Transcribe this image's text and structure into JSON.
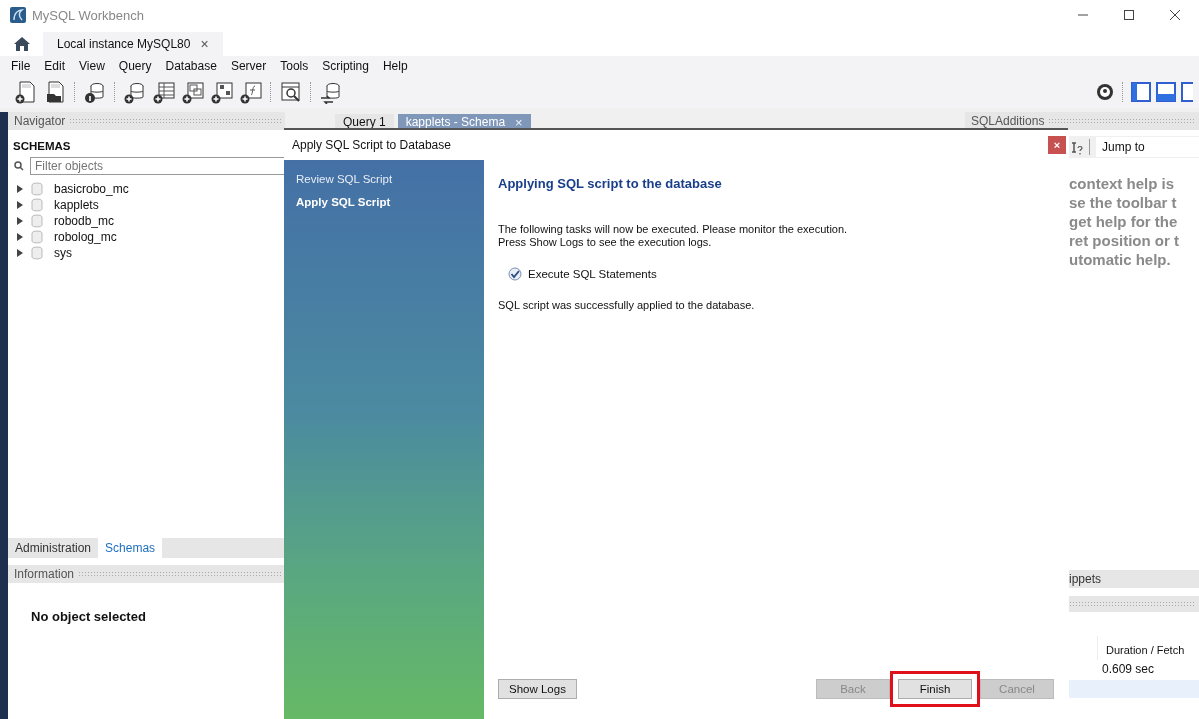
{
  "window": {
    "title": "MySQL Workbench"
  },
  "connection_tabs": [
    {
      "label": "Local instance MySQL80",
      "selected": true,
      "close": "×"
    }
  ],
  "menu": [
    "File",
    "Edit",
    "View",
    "Query",
    "Database",
    "Server",
    "Tools",
    "Scripting",
    "Help"
  ],
  "navigator": {
    "title": "Navigator",
    "section": "SCHEMAS",
    "filter_placeholder": "Filter objects",
    "schemas": [
      {
        "name": "basicrobo_mc",
        "expanded": false
      },
      {
        "name": "kapplets",
        "expanded": false
      },
      {
        "name": "robodb_mc",
        "expanded": false
      },
      {
        "name": "robolog_mc",
        "expanded": false
      },
      {
        "name": "sys",
        "expanded": false
      }
    ],
    "tabs": [
      {
        "label": "Administration",
        "selected": false
      },
      {
        "label": "Schemas",
        "selected": true
      }
    ],
    "info_title": "Information",
    "info_text": "No object selected"
  },
  "editor_tabs": [
    {
      "label": "Query 1",
      "selected": false
    },
    {
      "label": "kapplets - Schema",
      "selected": true,
      "close": "×"
    }
  ],
  "right_panel": {
    "title": "SQLAdditions",
    "jump_to": "Jump to",
    "help_lines": [
      "context help is",
      "se the toolbar t",
      "get help for the",
      "ret position or t",
      "utomatic help."
    ],
    "snippets_tab": "ippets",
    "column": "Duration / Fetch",
    "value": "0.609 sec"
  },
  "dialog": {
    "title": "Apply SQL Script to Database",
    "close": "×",
    "steps": [
      {
        "label": "Review SQL Script",
        "selected": false
      },
      {
        "label": "Apply SQL Script",
        "selected": true
      }
    ],
    "heading": "Applying SQL script to the database",
    "intro_lines": [
      "The following tasks will now be executed. Please monitor the execution.",
      "Press Show Logs to see the execution logs."
    ],
    "tasks": [
      {
        "label": "Execute SQL Statements",
        "done": true
      }
    ],
    "message": "SQL script was successfully applied to the database.",
    "show_logs": "Show Logs",
    "buttons": [
      {
        "label": "Back",
        "disabled": true,
        "highlighted": false
      },
      {
        "label": "Finish",
        "disabled": false,
        "highlighted": true
      },
      {
        "label": "Cancel",
        "disabled": true,
        "highlighted": false
      }
    ]
  }
}
